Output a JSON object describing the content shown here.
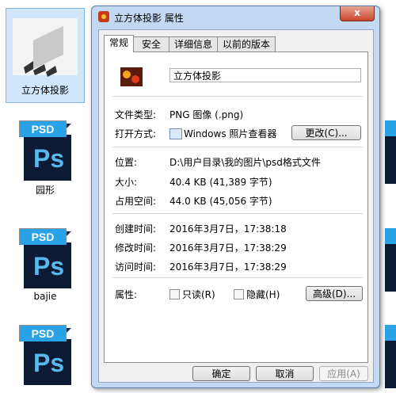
{
  "explorer": {
    "selected_file": {
      "label": "立方体投影"
    },
    "files": [
      {
        "label": "园形",
        "badge": "PSD",
        "mark": "Ps"
      },
      {
        "label": "bajie",
        "badge": "PSD",
        "mark": "Ps"
      },
      {
        "label": "",
        "badge": "PSD",
        "mark": "Ps"
      }
    ]
  },
  "dialog": {
    "title": "立方体投影 属性",
    "close_label": "x",
    "tabs": [
      "常规",
      "安全",
      "详细信息",
      "以前的版本"
    ],
    "active_tab": "常规",
    "file_name": "立方体投影",
    "fields": {
      "type_label": "文件类型:",
      "type_value": "PNG 图像 (.png)",
      "open_label": "打开方式:",
      "open_value": "Windows 照片查看器",
      "change_button": "更改(C)...",
      "location_label": "位置:",
      "location_value": "D:\\用户目录\\我的图片\\psd格式文件",
      "size_label": "大小:",
      "size_value": "40.4 KB (41,389 字节)",
      "disk_label": "占用空间:",
      "disk_value": "44.0 KB (45,056 字节)",
      "created_label": "创建时间:",
      "created_value": "2016年3月7日，17:38:18",
      "modified_label": "修改时间:",
      "modified_value": "2016年3月7日，17:38:29",
      "accessed_label": "访问时间:",
      "accessed_value": "2016年3月7日，17:38:29",
      "attrs_label": "属性:",
      "readonly_label": "只读(R)",
      "hidden_label": "隐藏(H)",
      "advanced_button": "高级(D)..."
    },
    "buttons": {
      "ok": "确定",
      "cancel": "取消",
      "apply": "应用(A)"
    }
  }
}
